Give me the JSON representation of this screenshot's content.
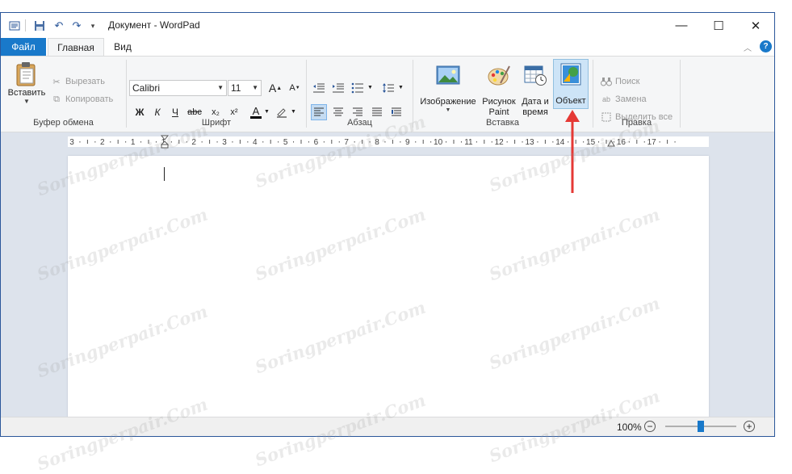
{
  "window": {
    "title": "Документ - WordPad",
    "controls": {
      "minimize": "—",
      "maximize": "☐",
      "close": "✕"
    }
  },
  "menu": {
    "tabs": [
      "Файл",
      "Главная",
      "Вид"
    ]
  },
  "ribbon": {
    "clipboard": {
      "paste": "Вставить",
      "cut": "Вырезать",
      "copy": "Копировать",
      "group_label": "Буфер обмена"
    },
    "font": {
      "family": "Calibri",
      "size": "11",
      "bold": "Ж",
      "italic": "К",
      "underline": "Ч",
      "strike": "abc",
      "subscript": "x₂",
      "superscript": "x²",
      "color_letter": "A",
      "group_label": "Шрифт"
    },
    "paragraph": {
      "group_label": "Абзац"
    },
    "insert": {
      "picture": "Изображение",
      "paint_line1": "Рисунок",
      "paint_line2": "Paint",
      "datetime_line1": "Дата и",
      "datetime_line2": "время",
      "object": "Объект",
      "group_label": "Вставка"
    },
    "edit": {
      "find": "Поиск",
      "replace": "Замена",
      "select_all": "Выделить все",
      "group_label": "Правка"
    }
  },
  "ruler": {
    "labels": [
      "3",
      "2",
      "1",
      "1",
      "2",
      "3",
      "4",
      "5",
      "6",
      "7",
      "8",
      "9",
      "10",
      "11",
      "12",
      "13",
      "14",
      "15",
      "16",
      "17"
    ]
  },
  "statusbar": {
    "zoom": "100%",
    "zoom_level_fraction": 0.5
  },
  "watermark": {
    "text": "Soringperpair.Com"
  },
  "colors": {
    "accent": "#1979ca",
    "annotation_arrow": "#e53935"
  }
}
